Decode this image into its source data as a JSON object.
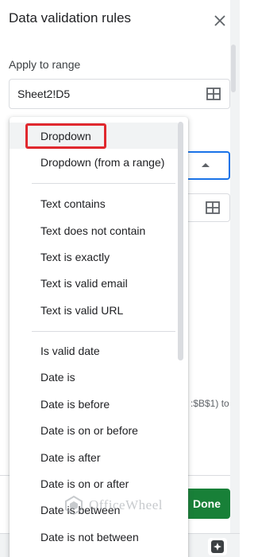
{
  "panel": {
    "title": "Data validation rules",
    "apply_to_range_label": "Apply to range",
    "range_value": "Sheet2!D5"
  },
  "background": {
    "helper_text": ":$B$1) to",
    "done_label": "Done"
  },
  "menu": {
    "items": [
      "Dropdown",
      "Dropdown (from a range)",
      "Text contains",
      "Text does not contain",
      "Text is exactly",
      "Text is valid email",
      "Text is valid URL",
      "Is valid date",
      "Date is",
      "Date is before",
      "Date is on or before",
      "Date is after",
      "Date is on or after",
      "Date is between",
      "Date is not between"
    ],
    "selected": "Dropdown"
  },
  "watermark": {
    "text": "OfficeWheel"
  },
  "colors": {
    "accent_blue": "#1a73e8",
    "done_green": "#188038",
    "highlight_red": "#e0282e"
  },
  "icons": {
    "close": "close-icon",
    "range_grid": "grid-icon",
    "explore": "explore-icon"
  }
}
